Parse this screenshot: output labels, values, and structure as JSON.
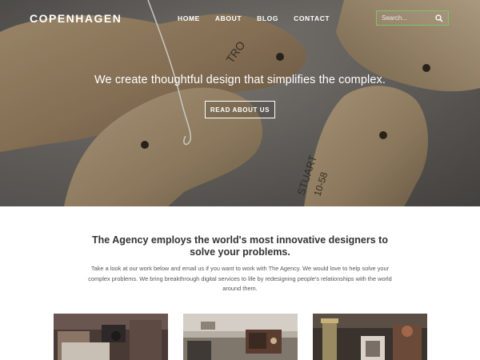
{
  "brand": {
    "logo_text": "COPENHAGEN"
  },
  "nav": {
    "items": [
      {
        "label": "HOME"
      },
      {
        "label": "ABOUT"
      },
      {
        "label": "BLOG"
      },
      {
        "label": "CONTACT"
      }
    ]
  },
  "search": {
    "placeholder": "Search...",
    "icon": "search-icon"
  },
  "hero": {
    "tagline": "We create thoughtful design that simplifies the complex.",
    "cta_label": "READ ABOUT US",
    "image_text": {
      "left": "TRO",
      "right_top": "STUART",
      "right_bottom": "10-58"
    }
  },
  "intro": {
    "headline": "The Agency employs the world's most innovative designers to solve your problems.",
    "body": "Take a look at our work below and email us if you want to work with The Agency. We would love to help solve your complex problems. We bring breakthrough digital services to life by redesigning people's relationships with the world around them."
  },
  "colors": {
    "search_border": "#7fc36a",
    "text_dark": "#333333",
    "text_body": "#555555"
  }
}
